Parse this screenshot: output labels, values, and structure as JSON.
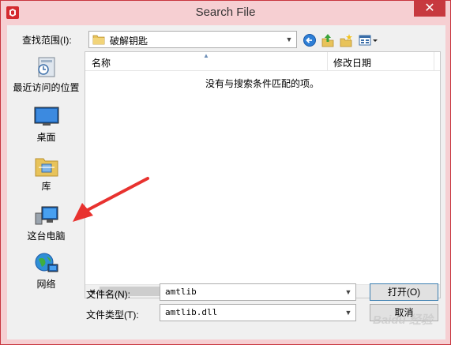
{
  "window": {
    "title": "Search File",
    "close_glyph": "✕"
  },
  "lookin": {
    "label": "查找范围(I):",
    "value": "破解钥匙"
  },
  "toolbar": {
    "icons": [
      "back-icon",
      "up-folder-icon",
      "new-folder-icon",
      "view-menu-icon"
    ]
  },
  "places": [
    {
      "name": "recent-places",
      "label": "最近访问的位置"
    },
    {
      "name": "desktop",
      "label": "桌面"
    },
    {
      "name": "libraries",
      "label": "库"
    },
    {
      "name": "this-pc",
      "label": "这台电脑"
    },
    {
      "name": "network",
      "label": "网络"
    }
  ],
  "listview": {
    "columns": [
      "名称",
      "修改日期"
    ],
    "empty_message": "没有与搜索条件匹配的项。"
  },
  "filename": {
    "label": "文件名(N):",
    "value": "amtlib"
  },
  "filetype": {
    "label": "文件类型(T):",
    "value": "amtlib.dll"
  },
  "buttons": {
    "open": "打开(O)",
    "cancel": "取消"
  },
  "watermark": "Baidu 经验",
  "colors": {
    "title_bar": "#f6cfd2",
    "close_button": "#c7393f",
    "annotation_arrow": "#e8322f"
  }
}
